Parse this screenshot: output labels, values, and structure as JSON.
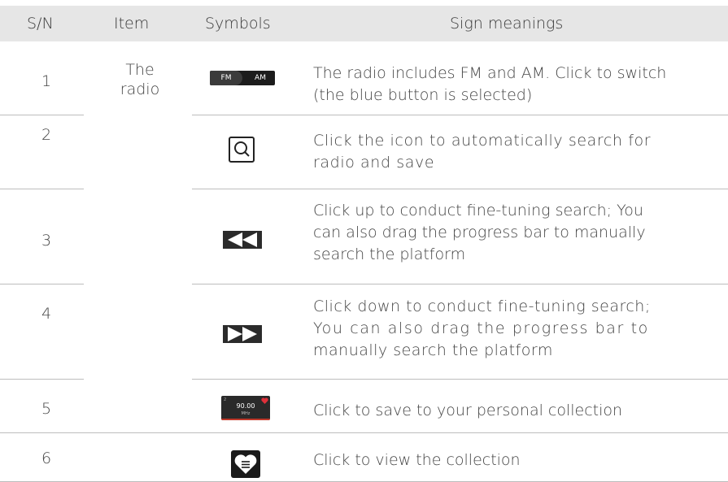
{
  "header": {
    "sn": "S/N",
    "item": "Item",
    "symbols": "Symbols",
    "meanings": "Sign meanings"
  },
  "item_label": "The\nradio",
  "item_line1": "The",
  "item_line2": "radio",
  "rows": [
    {
      "sn": "1",
      "symbol": {
        "type": "fm-am-switch",
        "fm": "FM",
        "am": "AM"
      },
      "lines": [
        "The radio includes FM and AM. Click to switch",
        "(the blue button is selected)"
      ]
    },
    {
      "sn": "2",
      "symbol": {
        "type": "search-icon"
      },
      "lines": [
        "Click the icon to automatically search for",
        "radio and save"
      ]
    },
    {
      "sn": "3",
      "symbol": {
        "type": "rewind-icon"
      },
      "lines": [
        "Click up to conduct fine-tuning search; You",
        "can also drag the progress bar to manually",
        "search the platform"
      ]
    },
    {
      "sn": "4",
      "symbol": {
        "type": "fast-forward-icon"
      },
      "lines": [
        "Click down to conduct fine-tuning search;",
        "You can also drag the progress bar to",
        "manually search the platform"
      ]
    },
    {
      "sn": "5",
      "symbol": {
        "type": "favorite-frequency-tile",
        "freq": "90.00",
        "unit": "MHz",
        "index": "2"
      },
      "lines": [
        "Click to save to your personal collection"
      ]
    },
    {
      "sn": "6",
      "symbol": {
        "type": "heart-list-icon"
      },
      "lines": [
        "Click to view the collection"
      ]
    }
  ],
  "colors": {
    "header_bg": "#e6e6e6",
    "text": "#444444",
    "separator": "#bdbdbd",
    "icon_dark": "#1c1c1c",
    "accent_red": "#e0303a"
  }
}
